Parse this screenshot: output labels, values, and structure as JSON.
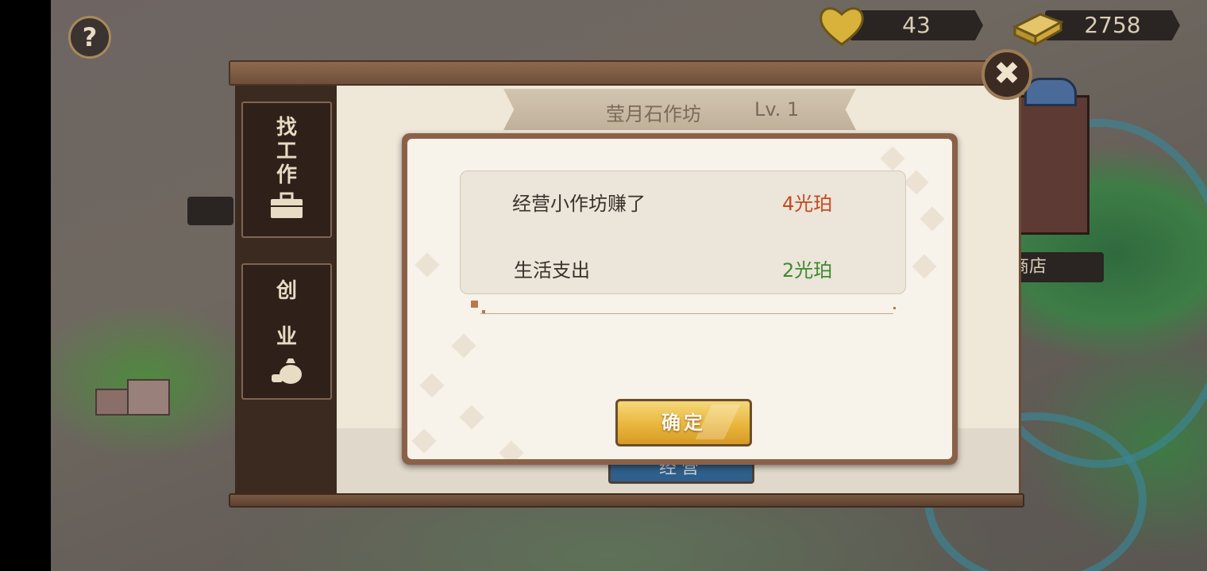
{
  "resources": {
    "hearts": "43",
    "gold": "2758"
  },
  "help": {
    "label": "?"
  },
  "panel": {
    "title": "莹月石作坊",
    "level": "Lv.  1",
    "tabs": [
      {
        "label_chars": [
          "找",
          "工",
          "作"
        ],
        "icon": "briefcase-icon"
      },
      {
        "label_chars": [
          "创",
          "业"
        ],
        "icon": "money-bag-icon"
      }
    ],
    "close_label": "✖",
    "run_button": "经营"
  },
  "map": {
    "shop_label": "商店"
  },
  "modal": {
    "rows": [
      {
        "label": "经营小作坊赚了",
        "value": "4光珀",
        "color": "#c44a1e"
      },
      {
        "label": "生活支出",
        "value": "2光珀",
        "color": "#3f8a2e"
      }
    ],
    "confirm": "确定"
  }
}
